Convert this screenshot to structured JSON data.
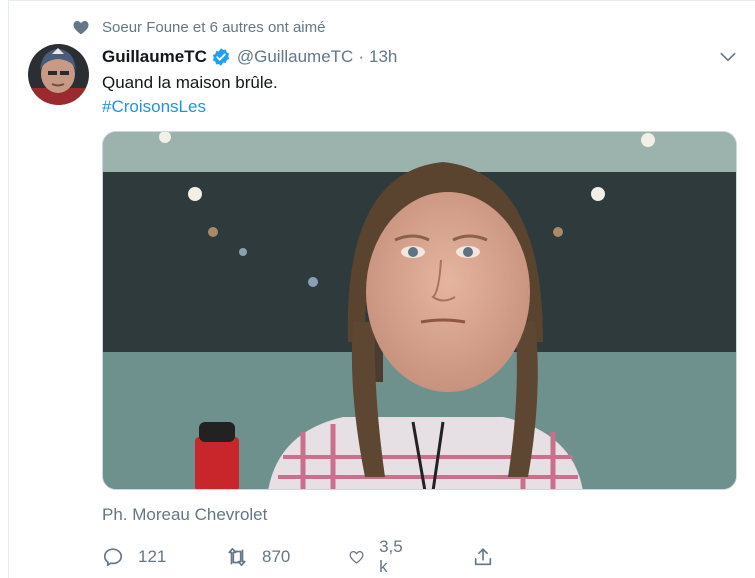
{
  "social_context": {
    "text": "Soeur Foune et 6 autres ont aimé",
    "icon": "heart-icon"
  },
  "author": {
    "name": "GuillaumeTC",
    "handle": "@GuillaumeTC",
    "separator": "·",
    "time": "13h",
    "verified": true
  },
  "tweet": {
    "text": "Quand la maison brûle.",
    "hashtag": "#CroisonsLes"
  },
  "media": {
    "credit": "Ph. Moreau Chevrolet"
  },
  "actions": {
    "replies": "121",
    "retweets": "870",
    "likes": "3,5 k"
  },
  "colors": {
    "link": "#1b95e0",
    "secondary": "#657786",
    "text": "#14171a",
    "verified": "#1da1f2"
  }
}
